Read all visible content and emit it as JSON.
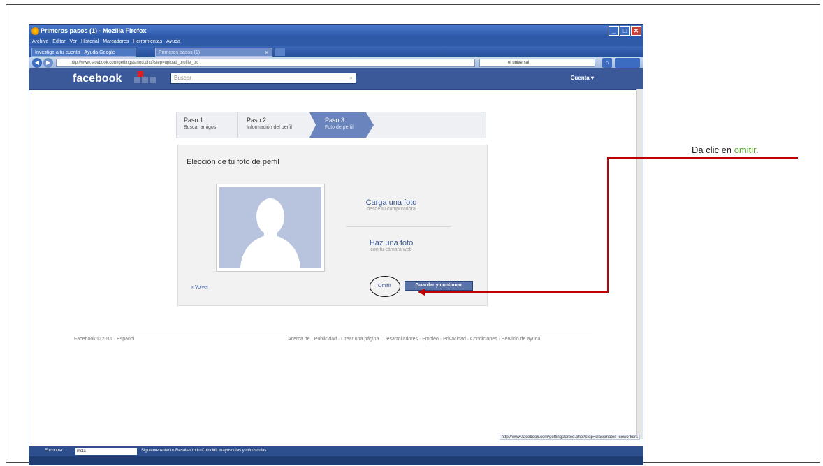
{
  "browser": {
    "window_title": "Primeros pasos (1) - Mozilla Firefox",
    "menu": [
      "Archivo",
      "Editar",
      "Ver",
      "Historial",
      "Marcadores",
      "Herramientas",
      "Ayuda"
    ],
    "tabs": [
      {
        "label": "Investiga a tu cuenta - Ayuda Google"
      },
      {
        "label": "Primeros pasos (1)"
      }
    ],
    "url": "http://www.facebook.com/gettingstarted.php?step=upload_profile_pic",
    "search_engine_text": "el universal"
  },
  "facebook": {
    "logo": "facebook",
    "search_placeholder": "Buscar",
    "account_label": "Cuenta ▾",
    "steps": [
      {
        "num": "Paso 1",
        "desc": "Buscar amigos"
      },
      {
        "num": "Paso 2",
        "desc": "Información del perfil"
      },
      {
        "num": "Paso 3",
        "desc": "Foto de perfil"
      }
    ],
    "panel": {
      "title": "Elección de tu foto de perfil",
      "upload": {
        "title": "Carga una foto",
        "sub": "desde tu computadora"
      },
      "take": {
        "title": "Haz una foto",
        "sub": "con tu cámara web"
      },
      "back_link": "« Volver",
      "skip_link": "Omitir",
      "continue_button": "Guardar y continuar"
    },
    "footer_left": "Facebook © 2011 · Español",
    "footer_right": "Acerca de · Publicidad · Crear una página · Desarrolladores · Empleo · Privacidad · Condiciones · Servicio de ayuda"
  },
  "statusbar": {
    "link_url": "http://www.facebook.com/gettingstarted.php?step=classmates_coworkers",
    "find_label": "Encontrar:",
    "find_value": "insta",
    "find_buttons": "Siguiente   Anterior   Resaltar todo   Coincidir mayúsculas y minúsculas"
  },
  "annotation": {
    "text_before": "Da clic en ",
    "highlight": "omitir",
    "text_after": "."
  },
  "colors": {
    "facebook_blue": "#3b5998",
    "annotation_arrow": "#c00000",
    "annotation_highlight": "#5aa832"
  }
}
